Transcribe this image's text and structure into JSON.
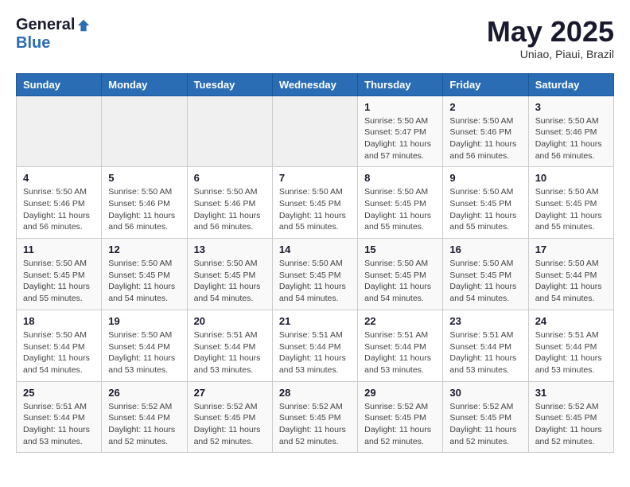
{
  "header": {
    "logo": {
      "general": "General",
      "blue": "Blue"
    },
    "title": "May 2025",
    "subtitle": "Uniao, Piaui, Brazil"
  },
  "weekdays": [
    "Sunday",
    "Monday",
    "Tuesday",
    "Wednesday",
    "Thursday",
    "Friday",
    "Saturday"
  ],
  "weeks": [
    [
      {
        "day": "",
        "info": ""
      },
      {
        "day": "",
        "info": ""
      },
      {
        "day": "",
        "info": ""
      },
      {
        "day": "",
        "info": ""
      },
      {
        "day": "1",
        "info": "Sunrise: 5:50 AM\nSunset: 5:47 PM\nDaylight: 11 hours\nand 57 minutes."
      },
      {
        "day": "2",
        "info": "Sunrise: 5:50 AM\nSunset: 5:46 PM\nDaylight: 11 hours\nand 56 minutes."
      },
      {
        "day": "3",
        "info": "Sunrise: 5:50 AM\nSunset: 5:46 PM\nDaylight: 11 hours\nand 56 minutes."
      }
    ],
    [
      {
        "day": "4",
        "info": "Sunrise: 5:50 AM\nSunset: 5:46 PM\nDaylight: 11 hours\nand 56 minutes."
      },
      {
        "day": "5",
        "info": "Sunrise: 5:50 AM\nSunset: 5:46 PM\nDaylight: 11 hours\nand 56 minutes."
      },
      {
        "day": "6",
        "info": "Sunrise: 5:50 AM\nSunset: 5:46 PM\nDaylight: 11 hours\nand 56 minutes."
      },
      {
        "day": "7",
        "info": "Sunrise: 5:50 AM\nSunset: 5:45 PM\nDaylight: 11 hours\nand 55 minutes."
      },
      {
        "day": "8",
        "info": "Sunrise: 5:50 AM\nSunset: 5:45 PM\nDaylight: 11 hours\nand 55 minutes."
      },
      {
        "day": "9",
        "info": "Sunrise: 5:50 AM\nSunset: 5:45 PM\nDaylight: 11 hours\nand 55 minutes."
      },
      {
        "day": "10",
        "info": "Sunrise: 5:50 AM\nSunset: 5:45 PM\nDaylight: 11 hours\nand 55 minutes."
      }
    ],
    [
      {
        "day": "11",
        "info": "Sunrise: 5:50 AM\nSunset: 5:45 PM\nDaylight: 11 hours\nand 55 minutes."
      },
      {
        "day": "12",
        "info": "Sunrise: 5:50 AM\nSunset: 5:45 PM\nDaylight: 11 hours\nand 54 minutes."
      },
      {
        "day": "13",
        "info": "Sunrise: 5:50 AM\nSunset: 5:45 PM\nDaylight: 11 hours\nand 54 minutes."
      },
      {
        "day": "14",
        "info": "Sunrise: 5:50 AM\nSunset: 5:45 PM\nDaylight: 11 hours\nand 54 minutes."
      },
      {
        "day": "15",
        "info": "Sunrise: 5:50 AM\nSunset: 5:45 PM\nDaylight: 11 hours\nand 54 minutes."
      },
      {
        "day": "16",
        "info": "Sunrise: 5:50 AM\nSunset: 5:45 PM\nDaylight: 11 hours\nand 54 minutes."
      },
      {
        "day": "17",
        "info": "Sunrise: 5:50 AM\nSunset: 5:44 PM\nDaylight: 11 hours\nand 54 minutes."
      }
    ],
    [
      {
        "day": "18",
        "info": "Sunrise: 5:50 AM\nSunset: 5:44 PM\nDaylight: 11 hours\nand 54 minutes."
      },
      {
        "day": "19",
        "info": "Sunrise: 5:50 AM\nSunset: 5:44 PM\nDaylight: 11 hours\nand 53 minutes."
      },
      {
        "day": "20",
        "info": "Sunrise: 5:51 AM\nSunset: 5:44 PM\nDaylight: 11 hours\nand 53 minutes."
      },
      {
        "day": "21",
        "info": "Sunrise: 5:51 AM\nSunset: 5:44 PM\nDaylight: 11 hours\nand 53 minutes."
      },
      {
        "day": "22",
        "info": "Sunrise: 5:51 AM\nSunset: 5:44 PM\nDaylight: 11 hours\nand 53 minutes."
      },
      {
        "day": "23",
        "info": "Sunrise: 5:51 AM\nSunset: 5:44 PM\nDaylight: 11 hours\nand 53 minutes."
      },
      {
        "day": "24",
        "info": "Sunrise: 5:51 AM\nSunset: 5:44 PM\nDaylight: 11 hours\nand 53 minutes."
      }
    ],
    [
      {
        "day": "25",
        "info": "Sunrise: 5:51 AM\nSunset: 5:44 PM\nDaylight: 11 hours\nand 53 minutes."
      },
      {
        "day": "26",
        "info": "Sunrise: 5:52 AM\nSunset: 5:44 PM\nDaylight: 11 hours\nand 52 minutes."
      },
      {
        "day": "27",
        "info": "Sunrise: 5:52 AM\nSunset: 5:45 PM\nDaylight: 11 hours\nand 52 minutes."
      },
      {
        "day": "28",
        "info": "Sunrise: 5:52 AM\nSunset: 5:45 PM\nDaylight: 11 hours\nand 52 minutes."
      },
      {
        "day": "29",
        "info": "Sunrise: 5:52 AM\nSunset: 5:45 PM\nDaylight: 11 hours\nand 52 minutes."
      },
      {
        "day": "30",
        "info": "Sunrise: 5:52 AM\nSunset: 5:45 PM\nDaylight: 11 hours\nand 52 minutes."
      },
      {
        "day": "31",
        "info": "Sunrise: 5:52 AM\nSunset: 5:45 PM\nDaylight: 11 hours\nand 52 minutes."
      }
    ]
  ]
}
